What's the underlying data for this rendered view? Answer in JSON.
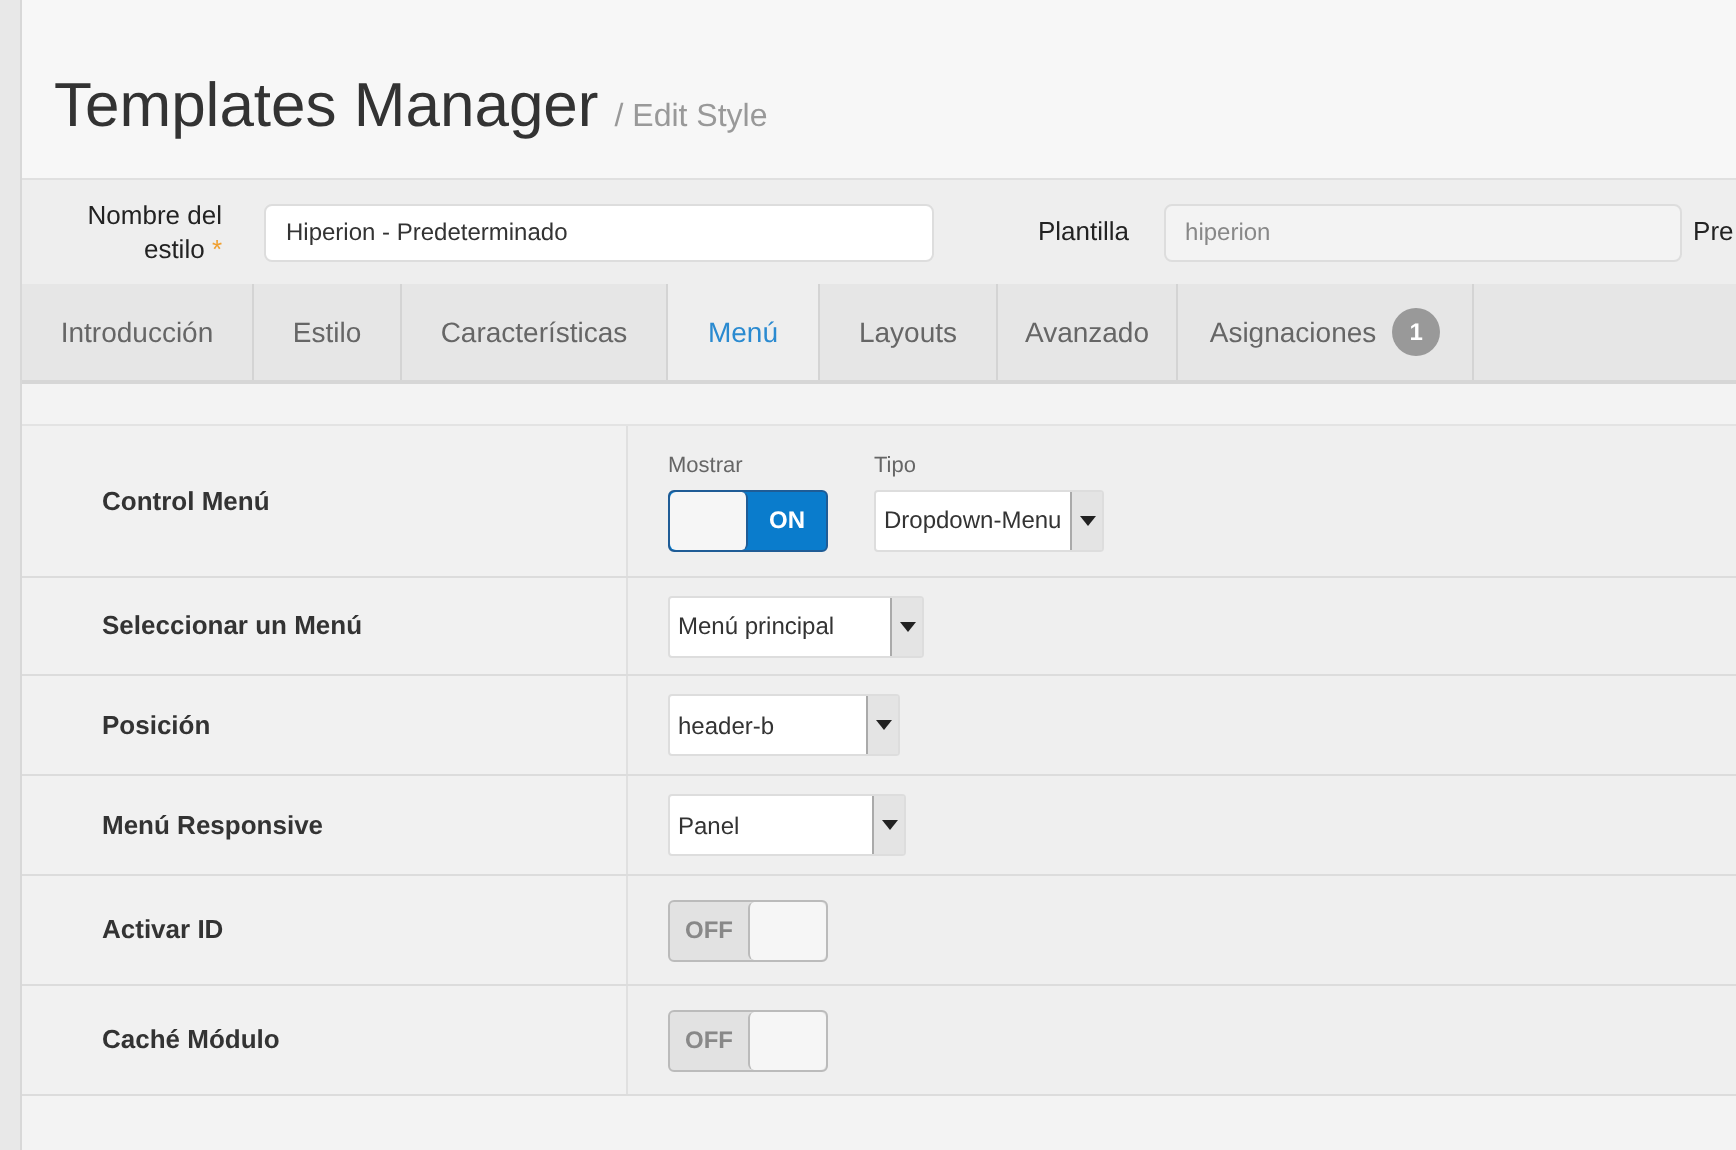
{
  "header": {
    "title": "Templates Manager",
    "subtitle": "/ Edit Style"
  },
  "form": {
    "name_label": "Nombre del estilo",
    "required_mark": "*",
    "name_value": "Hiperion - Predeterminado",
    "template_label": "Plantilla",
    "template_value": "hiperion",
    "cut_label": "Pre"
  },
  "tabs": [
    {
      "label": "Introducción",
      "selected": false
    },
    {
      "label": "Estilo",
      "selected": false
    },
    {
      "label": "Características",
      "selected": false
    },
    {
      "label": "Menú",
      "selected": true
    },
    {
      "label": "Layouts",
      "selected": false
    },
    {
      "label": "Avanzado",
      "selected": false
    },
    {
      "label": "Asignaciones",
      "selected": false,
      "badge": "1"
    }
  ],
  "rows": [
    {
      "label": "Control Menú",
      "kind": "toggle_select",
      "toggle_caption": "Mostrar",
      "toggle": {
        "text": "ON",
        "on": true
      },
      "select_caption": "Tipo",
      "select_value": "Dropdown-Menu"
    },
    {
      "label": "Seleccionar un Menú",
      "kind": "select",
      "select_value": "Menú principal"
    },
    {
      "label": "Posición",
      "kind": "select",
      "select_value": "header-b"
    },
    {
      "label": "Menú Responsive",
      "kind": "select",
      "select_value": "Panel"
    },
    {
      "label": "Activar ID",
      "kind": "toggle",
      "toggle": {
        "text": "OFF",
        "on": false
      }
    },
    {
      "label": "Caché Módulo",
      "kind": "toggle",
      "toggle": {
        "text": "OFF",
        "on": false
      }
    }
  ]
}
